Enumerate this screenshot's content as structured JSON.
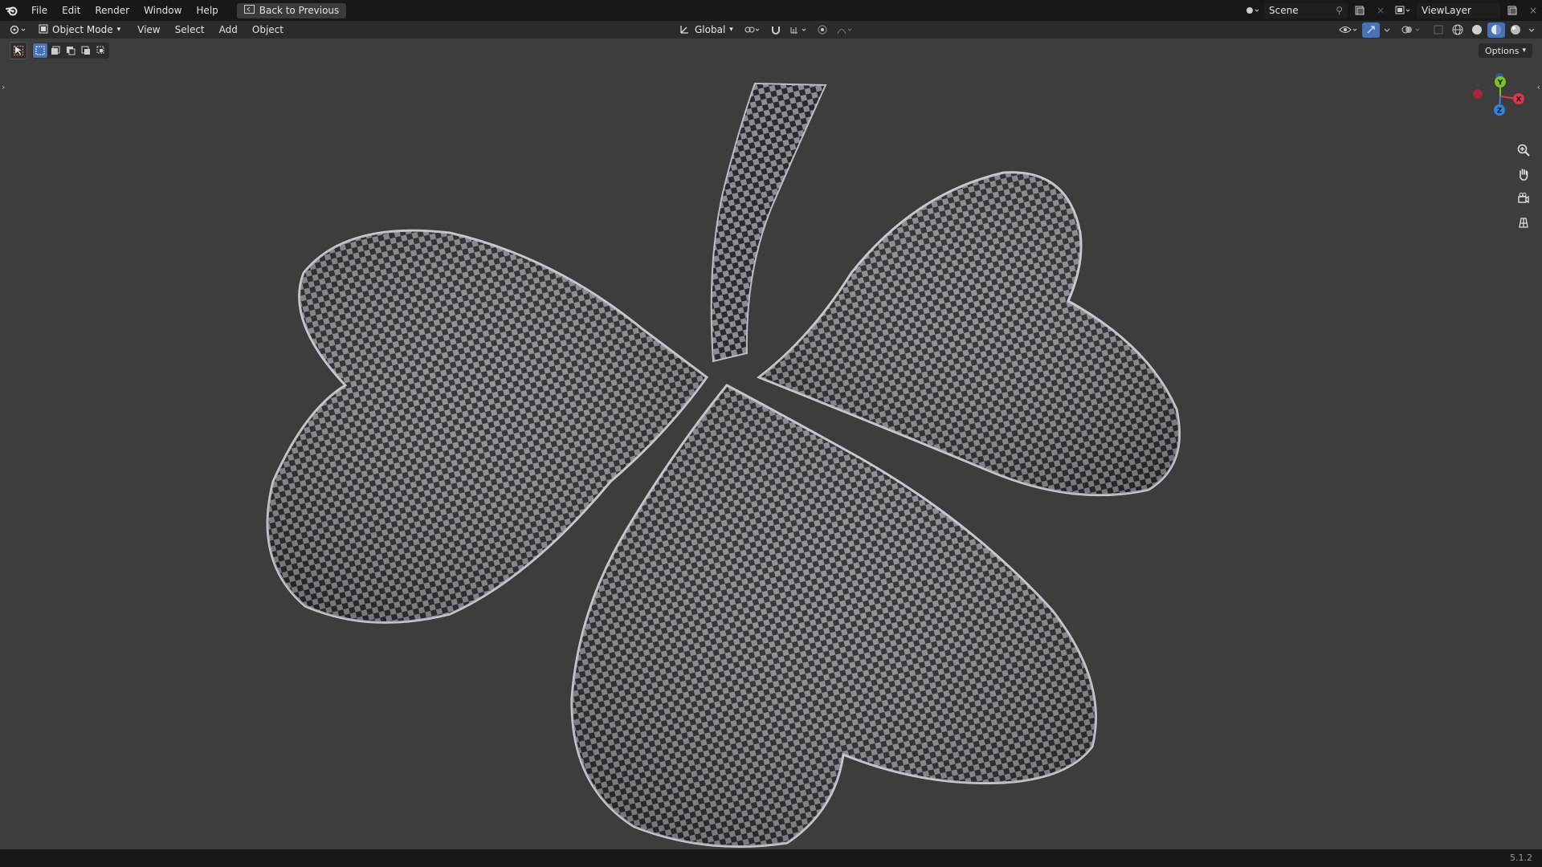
{
  "topbar": {
    "menus": [
      "File",
      "Edit",
      "Render",
      "Window",
      "Help"
    ],
    "back_label": "Back to Previous",
    "scene_label": "Scene",
    "viewlayer_label": "ViewLayer"
  },
  "header": {
    "mode_label": "Object Mode",
    "menus": [
      "View",
      "Select",
      "Add",
      "Object"
    ],
    "transform_orientation": "Global"
  },
  "viewport": {
    "options_label": "Options",
    "gizmo": {
      "x_label": "X",
      "y_label": "Y",
      "z_label": "Z"
    }
  },
  "status": {
    "version": "5.1.2"
  },
  "colors": {
    "axis_x": "#e0344b",
    "axis_y": "#7cc41f",
    "axis_z": "#2f84e3",
    "accent": "#4772b3"
  },
  "icons": [
    "blender-logo-icon",
    "back-icon",
    "editor-type-icon",
    "object-mode-icon",
    "transform-icon",
    "pivot-icon",
    "snap-icon",
    "proportional-icon",
    "visibility-icon",
    "gizmo-icon",
    "overlay-icon",
    "xray-icon",
    "wireframe-shading-icon",
    "solid-shading-icon",
    "material-shading-icon",
    "rendered-shading-icon",
    "zoom-icon",
    "pan-hand-icon",
    "camera-icon",
    "grid-icon"
  ]
}
